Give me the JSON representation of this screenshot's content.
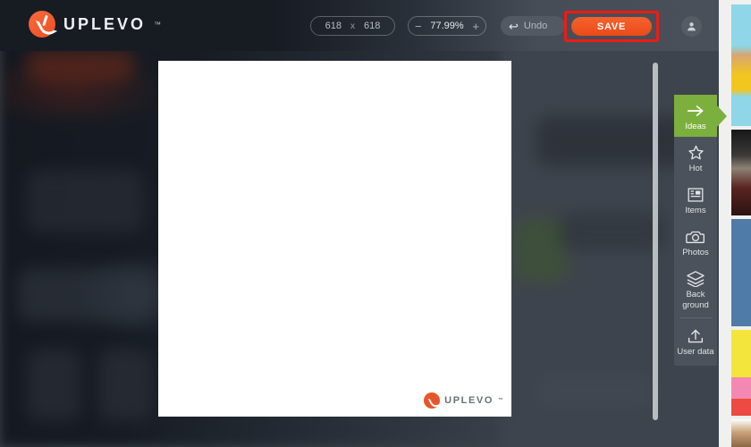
{
  "app": {
    "brand": "UPLEVO",
    "brand_tm": "™",
    "logo_icon": "uplevo-logo-icon"
  },
  "toolbar": {
    "width_value": "618",
    "separator": "x",
    "height_value": "618",
    "zoom_out_label": "−",
    "zoom_value": "77.99%",
    "zoom_in_label": "+",
    "undo_icon": "undo-arrow-icon",
    "undo_label": "Undo",
    "save_label": "SAVE",
    "save_highlight_color": "#f01b13",
    "save_color": "#ee4f1e",
    "avatar_icon": "user-avatar-icon"
  },
  "canvas": {
    "watermark_text": "UPLEVO",
    "watermark_tm": "™",
    "watermark_icon": "uplevo-watermark-icon"
  },
  "rail": {
    "active_color": "#7cb03e",
    "items": [
      {
        "label": "Ideas",
        "icon": "arrow-right-icon",
        "active": true
      },
      {
        "label": "Hot",
        "icon": "star-icon",
        "active": false
      },
      {
        "label": "Items",
        "icon": "layout-items-icon",
        "active": false
      },
      {
        "label": "Photos",
        "icon": "camera-icon",
        "active": false
      },
      {
        "label": "Back ground",
        "line1": "Back",
        "line2": "ground",
        "icon": "layers-icon",
        "active": false
      },
      {
        "label": "User data",
        "icon": "upload-icon",
        "active": false
      }
    ]
  },
  "template_panel": {
    "thumbnails": [
      {
        "name": "template-thumb-1",
        "color": "#8ed6e8"
      },
      {
        "name": "template-thumb-2",
        "color": "#3b3a38"
      },
      {
        "name": "template-thumb-3",
        "color": "#4f7ba8"
      },
      {
        "name": "template-thumb-4",
        "color": "#f4e53c"
      },
      {
        "name": "template-thumb-5",
        "color": "#c9a378"
      }
    ]
  }
}
